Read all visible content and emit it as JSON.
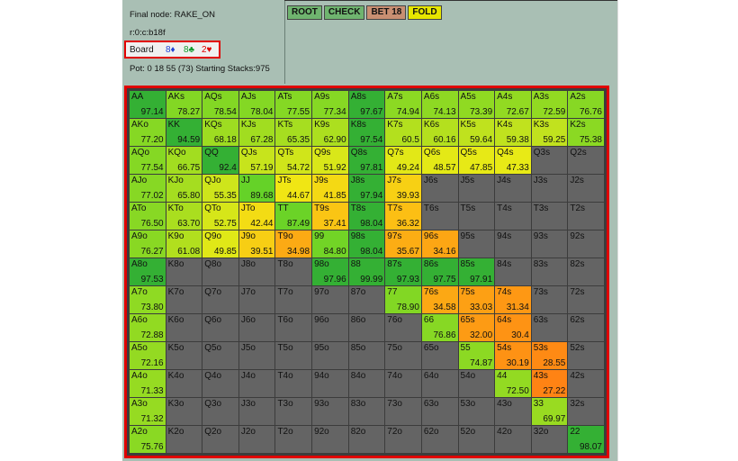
{
  "info": {
    "final_node": "Final node:  RAKE_ON",
    "node_id": "r:0:c:b18f",
    "board_label": "Board",
    "board_cards": [
      {
        "text": "8♦",
        "color": "#1f3fd6"
      },
      {
        "text": "8♣",
        "color": "#0f9a2a"
      },
      {
        "text": "2♥",
        "color": "#e00000"
      }
    ],
    "pot": "Pot: 0 18 55 (73) Starting Stacks:975"
  },
  "actions": [
    {
      "label": "ROOT",
      "color": "#6fb46f"
    },
    {
      "label": "CHECK",
      "color": "#6fb46f"
    },
    {
      "label": "BET 18",
      "color": "#c98f72"
    },
    {
      "label": "FOLD",
      "color": "#e6e600"
    }
  ],
  "grid": [
    [
      [
        "AA",
        "97.14"
      ],
      [
        "AKs",
        "78.27"
      ],
      [
        "AQs",
        "78.54"
      ],
      [
        "AJs",
        "78.04"
      ],
      [
        "ATs",
        "77.55"
      ],
      [
        "A9s",
        "77.34"
      ],
      [
        "A8s",
        "97.67"
      ],
      [
        "A7s",
        "74.94"
      ],
      [
        "A6s",
        "74.13"
      ],
      [
        "A5s",
        "73.39"
      ],
      [
        "A4s",
        "72.67"
      ],
      [
        "A3s",
        "72.59"
      ],
      [
        "A2s",
        "76.76"
      ]
    ],
    [
      [
        "AKo",
        "77.20"
      ],
      [
        "KK",
        "94.59"
      ],
      [
        "KQs",
        "68.18"
      ],
      [
        "KJs",
        "67.28"
      ],
      [
        "KTs",
        "65.35"
      ],
      [
        "K9s",
        "62.90"
      ],
      [
        "K8s",
        "97.54"
      ],
      [
        "K7s",
        "60.5"
      ],
      [
        "K6s",
        "60.16"
      ],
      [
        "K5s",
        "59.64"
      ],
      [
        "K4s",
        "59.38"
      ],
      [
        "K3s",
        "59.25"
      ],
      [
        "K2s",
        "75.38"
      ]
    ],
    [
      [
        "AQo",
        "77.54"
      ],
      [
        "KQo",
        "66.75"
      ],
      [
        "QQ",
        "92.4"
      ],
      [
        "QJs",
        "57.19"
      ],
      [
        "QTs",
        "54.72"
      ],
      [
        "Q9s",
        "51.92"
      ],
      [
        "Q8s",
        "97.81"
      ],
      [
        "Q7s",
        "49.24"
      ],
      [
        "Q6s",
        "48.57"
      ],
      [
        "Q5s",
        "47.85"
      ],
      [
        "Q4s",
        "47.33"
      ],
      [
        "Q3s",
        ""
      ],
      [
        "Q2s",
        ""
      ]
    ],
    [
      [
        "AJo",
        "77.02"
      ],
      [
        "KJo",
        "65.80"
      ],
      [
        "QJo",
        "55.35"
      ],
      [
        "JJ",
        "89.68"
      ],
      [
        "JTs",
        "44.67"
      ],
      [
        "J9s",
        "41.85"
      ],
      [
        "J8s",
        "97.94"
      ],
      [
        "J7s",
        "39.93"
      ],
      [
        "J6s",
        ""
      ],
      [
        "J5s",
        ""
      ],
      [
        "J4s",
        ""
      ],
      [
        "J3s",
        ""
      ],
      [
        "J2s",
        ""
      ]
    ],
    [
      [
        "ATo",
        "76.50"
      ],
      [
        "KTo",
        "63.70"
      ],
      [
        "QTo",
        "52.75"
      ],
      [
        "JTo",
        "42.44"
      ],
      [
        "TT",
        "87.49"
      ],
      [
        "T9s",
        "37.41"
      ],
      [
        "T8s",
        "98.04"
      ],
      [
        "T7s",
        "36.32"
      ],
      [
        "T6s",
        ""
      ],
      [
        "T5s",
        ""
      ],
      [
        "T4s",
        ""
      ],
      [
        "T3s",
        ""
      ],
      [
        "T2s",
        ""
      ]
    ],
    [
      [
        "A9o",
        "76.27"
      ],
      [
        "K9o",
        "61.08"
      ],
      [
        "Q9o",
        "49.85"
      ],
      [
        "J9o",
        "39.51"
      ],
      [
        "T9o",
        "34.98"
      ],
      [
        "99",
        "84.80"
      ],
      [
        "98s",
        "98.04"
      ],
      [
        "97s",
        "35.67"
      ],
      [
        "96s",
        "34.16"
      ],
      [
        "95s",
        ""
      ],
      [
        "94s",
        ""
      ],
      [
        "93s",
        ""
      ],
      [
        "92s",
        ""
      ]
    ],
    [
      [
        "A8o",
        "97.53"
      ],
      [
        "K8o",
        ""
      ],
      [
        "Q8o",
        ""
      ],
      [
        "J8o",
        ""
      ],
      [
        "T8o",
        ""
      ],
      [
        "98o",
        "97.96"
      ],
      [
        "88",
        "99.99"
      ],
      [
        "87s",
        "97.93"
      ],
      [
        "86s",
        "97.75"
      ],
      [
        "85s",
        "97.91"
      ],
      [
        "84s",
        ""
      ],
      [
        "83s",
        ""
      ],
      [
        "82s",
        ""
      ]
    ],
    [
      [
        "A7o",
        "73.80"
      ],
      [
        "K7o",
        ""
      ],
      [
        "Q7o",
        ""
      ],
      [
        "J7o",
        ""
      ],
      [
        "T7o",
        ""
      ],
      [
        "97o",
        ""
      ],
      [
        "87o",
        ""
      ],
      [
        "77",
        "78.90"
      ],
      [
        "76s",
        "34.58"
      ],
      [
        "75s",
        "33.03"
      ],
      [
        "74s",
        "31.34"
      ],
      [
        "73s",
        ""
      ],
      [
        "72s",
        ""
      ]
    ],
    [
      [
        "A6o",
        "72.88"
      ],
      [
        "K6o",
        ""
      ],
      [
        "Q6o",
        ""
      ],
      [
        "J6o",
        ""
      ],
      [
        "T6o",
        ""
      ],
      [
        "96o",
        ""
      ],
      [
        "86o",
        ""
      ],
      [
        "76o",
        ""
      ],
      [
        "66",
        "76.86"
      ],
      [
        "65s",
        "32.00"
      ],
      [
        "64s",
        "30.4"
      ],
      [
        "63s",
        ""
      ],
      [
        "62s",
        ""
      ]
    ],
    [
      [
        "A5o",
        "72.16"
      ],
      [
        "K5o",
        ""
      ],
      [
        "Q5o",
        ""
      ],
      [
        "J5o",
        ""
      ],
      [
        "T5o",
        ""
      ],
      [
        "95o",
        ""
      ],
      [
        "85o",
        ""
      ],
      [
        "75o",
        ""
      ],
      [
        "65o",
        ""
      ],
      [
        "55",
        "74.87"
      ],
      [
        "54s",
        "30.19"
      ],
      [
        "53s",
        "28.55"
      ],
      [
        "52s",
        ""
      ]
    ],
    [
      [
        "A4o",
        "71.33"
      ],
      [
        "K4o",
        ""
      ],
      [
        "Q4o",
        ""
      ],
      [
        "J4o",
        ""
      ],
      [
        "T4o",
        ""
      ],
      [
        "94o",
        ""
      ],
      [
        "84o",
        ""
      ],
      [
        "74o",
        ""
      ],
      [
        "64o",
        ""
      ],
      [
        "54o",
        ""
      ],
      [
        "44",
        "72.50"
      ],
      [
        "43s",
        "27.22"
      ],
      [
        "42s",
        ""
      ]
    ],
    [
      [
        "A3o",
        "71.32"
      ],
      [
        "K3o",
        ""
      ],
      [
        "Q3o",
        ""
      ],
      [
        "J3o",
        ""
      ],
      [
        "T3o",
        ""
      ],
      [
        "93o",
        ""
      ],
      [
        "83o",
        ""
      ],
      [
        "73o",
        ""
      ],
      [
        "63o",
        ""
      ],
      [
        "53o",
        ""
      ],
      [
        "43o",
        ""
      ],
      [
        "33",
        "69.97"
      ],
      [
        "32s",
        ""
      ]
    ],
    [
      [
        "A2o",
        "75.76"
      ],
      [
        "K2o",
        ""
      ],
      [
        "Q2o",
        ""
      ],
      [
        "J2o",
        ""
      ],
      [
        "T2o",
        ""
      ],
      [
        "92o",
        ""
      ],
      [
        "82o",
        ""
      ],
      [
        "72o",
        ""
      ],
      [
        "62o",
        ""
      ],
      [
        "52o",
        ""
      ],
      [
        "42o",
        ""
      ],
      [
        "32o",
        ""
      ],
      [
        "22",
        "98.07"
      ]
    ]
  ],
  "colors": {
    "fold": "#646464",
    "high": "#2dbf3a",
    "mid": "#e8e800",
    "low": "#ff8c00"
  }
}
